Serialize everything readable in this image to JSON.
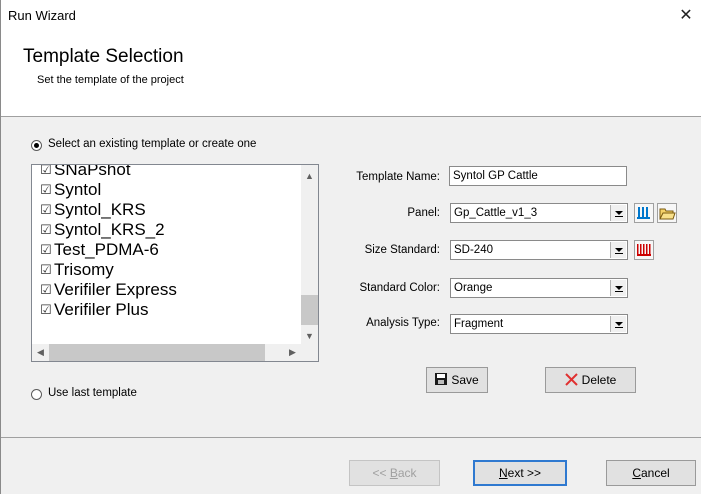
{
  "window": {
    "title": "Run Wizard",
    "close_glyph": "✕"
  },
  "header": {
    "title": "Template Selection",
    "subtitle": "Set the template of the project"
  },
  "options": {
    "select_existing_label": "Select an existing template or create one",
    "use_last_label": "Use last template",
    "selected": "select_existing"
  },
  "templates": [
    {
      "name": "SNaPshot",
      "checked": true
    },
    {
      "name": "Syntol",
      "checked": true
    },
    {
      "name": "Syntol_KRS",
      "checked": true
    },
    {
      "name": "Syntol_KRS_2",
      "checked": true
    },
    {
      "name": "Test_PDMA-6",
      "checked": true
    },
    {
      "name": "Trisomy",
      "checked": true
    },
    {
      "name": "Verifiler Express",
      "checked": true
    },
    {
      "name": "Verifiler Plus",
      "checked": true
    }
  ],
  "form": {
    "template_name_label": "Template Name:",
    "template_name_value": "Syntol GP Cattle",
    "panel_label": "Panel:",
    "panel_value": "Gp_Cattle_v1_3",
    "size_standard_label": "Size Standard:",
    "size_standard_value": "SD-240",
    "standard_color_label": "Standard Color:",
    "standard_color_value": "Orange",
    "analysis_type_label": "Analysis Type:",
    "analysis_type_value": "Fragment"
  },
  "actions": {
    "save": "Save",
    "delete": "Delete"
  },
  "footer": {
    "back": "<< Back",
    "next": "Next >>",
    "cancel": "Cancel"
  },
  "colors": {
    "panel_icon": "#0077cc",
    "size_icon": "#cc0000",
    "delete_x": "#e03030",
    "default_border": "#2f79d0"
  }
}
